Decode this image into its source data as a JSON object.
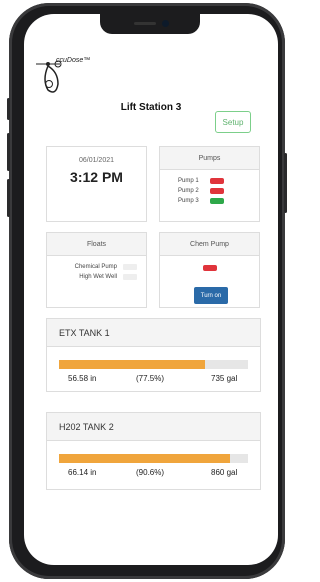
{
  "app": {
    "logo_text": "ccuDose™",
    "station_title": "Lift Station 3",
    "setup_label": "Setup"
  },
  "datetime": {
    "date": "06/01/2021",
    "time": "3:12 PM"
  },
  "pumps": {
    "title": "Pumps",
    "items": [
      {
        "label": "Pump 1",
        "status_color": "#e0343b"
      },
      {
        "label": "Pump 2",
        "status_color": "#e0343b"
      },
      {
        "label": "Pump 3",
        "status_color": "#2ea84a"
      }
    ]
  },
  "floats": {
    "title": "Floats",
    "items": [
      {
        "label": "Chemical Pump"
      },
      {
        "label": "High Wet Well"
      }
    ]
  },
  "chem_pump": {
    "title": "Chem Pump",
    "status_color": "#e0343b",
    "button_label": "Turn on"
  },
  "tanks": [
    {
      "name": "ETX TANK 1",
      "level": "56.58 in",
      "percent": "(77.5%)",
      "fill_percent": 77.5,
      "volume": "735 gal"
    },
    {
      "name": "H202 TANK 2",
      "level": "66.14 in",
      "percent": "(90.6%)",
      "fill_percent": 90.6,
      "volume": "860 gal"
    }
  ],
  "colors": {
    "bar_fill": "#f0a53c",
    "button_blue": "#2a6aa8",
    "setup_green": "#5fb36e"
  }
}
